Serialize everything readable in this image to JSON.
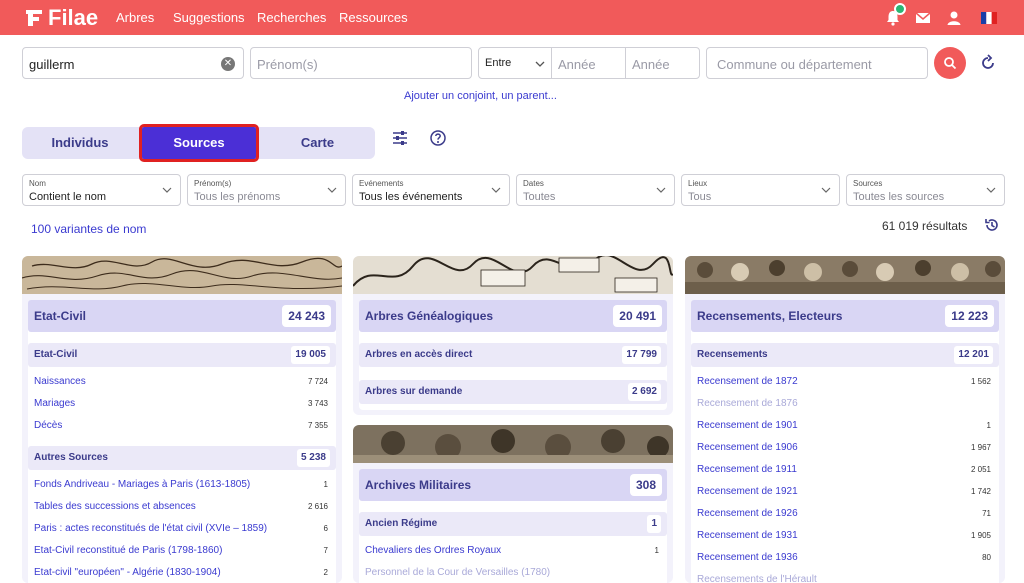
{
  "header": {
    "brand": "Filae",
    "nav": [
      "Arbres",
      "Suggestions",
      "Recherches",
      "Ressources"
    ],
    "icons": [
      "bell-icon",
      "mail-icon",
      "user-icon",
      "flag-fr-icon"
    ],
    "brand_color": "#f15a5a"
  },
  "search": {
    "name_value": "guillerm",
    "firstname_placeholder": "Prénom(s)",
    "range_select": "Entre",
    "year_from_placeholder": "Année",
    "year_to_placeholder": "Année",
    "place_placeholder": "Commune ou département",
    "add_link": "Ajouter un conjoint, un parent..."
  },
  "tabs": [
    {
      "label": "Individus",
      "active": false
    },
    {
      "label": "Sources",
      "active": true
    },
    {
      "label": "Carte",
      "active": false
    }
  ],
  "filters": [
    {
      "label": "Nom",
      "value": "Contient le nom"
    },
    {
      "label": "Prénom(s)",
      "value": "Tous les prénoms"
    },
    {
      "label": "Evénements",
      "value": "Tous les événements"
    },
    {
      "label": "Dates",
      "value": "Toutes"
    },
    {
      "label": "Lieux",
      "value": "Tous"
    },
    {
      "label": "Sources",
      "value": "Toutes les sources"
    }
  ],
  "variants_link": "100 variantes de nom",
  "results_count": "61 019 résultats",
  "columns": [
    {
      "title": "Etat-Civil",
      "count": "24 243",
      "groups": [
        {
          "title": "Etat-Civil",
          "count": "19 005",
          "rows": [
            {
              "label": "Naissances",
              "value": "7 724"
            },
            {
              "label": "Mariages",
              "value": "3 743"
            },
            {
              "label": "Décès",
              "value": "7 355"
            }
          ]
        },
        {
          "title": "Autres Sources",
          "count": "5 238",
          "rows": [
            {
              "label": "Fonds Andriveau - Mariages à Paris (1613-1805)",
              "value": "1"
            },
            {
              "label": "Tables des successions et absences",
              "value": "2 616"
            },
            {
              "label": "Paris : actes reconstitués de l'état civil (XVIe – 1859)",
              "value": "6"
            },
            {
              "label": "Etat-Civil reconstitué de Paris (1798-1860)",
              "value": "7"
            },
            {
              "label": "Etat-civil \"européen\" - Algérie (1830-1904)",
              "value": "2"
            }
          ]
        }
      ]
    },
    {
      "title": "Arbres Généalogiques",
      "count": "20 491",
      "groups": [
        {
          "title": "Arbres en accès direct",
          "count": "17 799"
        },
        {
          "title": "Arbres sur demande",
          "count": "2 692"
        }
      ]
    },
    {
      "title": "Archives Militaires",
      "count": "308",
      "groups": [
        {
          "title": "Ancien Régime",
          "count": "1",
          "rows": [
            {
              "label": "Chevaliers des Ordres Royaux",
              "value": "1"
            },
            {
              "label": "Personnel de la Cour de Versailles (1780)",
              "value": ""
            }
          ]
        }
      ]
    },
    {
      "title": "Recensements, Electeurs",
      "count": "12 223",
      "groups": [
        {
          "title": "Recensements",
          "count": "12 201",
          "rows": [
            {
              "label": "Recensement de 1872",
              "value": "1 562"
            },
            {
              "label": "Recensement de 1876",
              "value": ""
            },
            {
              "label": "Recensement de 1901",
              "value": "1"
            },
            {
              "label": "Recensement de 1906",
              "value": "1 967"
            },
            {
              "label": "Recensement de 1911",
              "value": "2 051"
            },
            {
              "label": "Recensement de 1921",
              "value": "1 742"
            },
            {
              "label": "Recensement de 1926",
              "value": "71"
            },
            {
              "label": "Recensement de 1931",
              "value": "1 905"
            },
            {
              "label": "Recensement de 1936",
              "value": "80"
            },
            {
              "label": "Recensements de l'Hérault",
              "value": ""
            }
          ]
        }
      ]
    }
  ]
}
